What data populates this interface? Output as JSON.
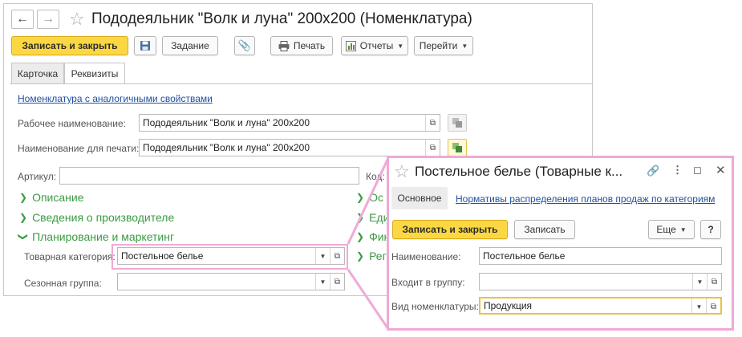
{
  "main": {
    "nav": {
      "back_icon": "arrow-left-icon",
      "forward_icon": "arrow-right-icon"
    },
    "title": "Пододеяльник \"Волк и луна\" 200х200 (Номенклатура)",
    "toolbar": {
      "save_close": "Записать и закрыть",
      "task": "Задание",
      "print": "Печать",
      "reports": "Отчеты",
      "goto": "Перейти"
    },
    "tabs": [
      "Карточка",
      "Реквизиты"
    ],
    "similar_link": "Номенклатура с аналогичными свойствами",
    "work_name_label": "Рабочее наименование:",
    "work_name_value": "Пододеяльник \"Волк и луна\" 200х200",
    "print_name_label": "Наименование для печати:",
    "print_name_value": "Пододеяльник \"Волк и луна\" 200х200",
    "article_label": "Артикул:",
    "article_value": "",
    "code_label": "Код:",
    "groups_left": [
      "Описание",
      "Сведения о производителе",
      "Планирование и маркетинг"
    ],
    "groups_right": [
      "Ос",
      "Еди",
      "Фин",
      "Рег"
    ],
    "category_label": "Товарная категория:",
    "category_value": "Постельное белье",
    "season_label": "Сезонная группа:",
    "season_value": ""
  },
  "popup": {
    "title": "Постельное белье (Товарные к...",
    "tab_main": "Основное",
    "norms_link": "Нормативы распределения планов продаж по категориям",
    "save_close": "Записать и закрыть",
    "save": "Записать",
    "more": "Еще",
    "help": "?",
    "name_label": "Наименование:",
    "name_value": "Постельное белье",
    "group_label": "Входит в группу:",
    "group_value": "",
    "kind_label": "Вид номенклатуры:",
    "kind_value": "Продукция"
  },
  "colors": {
    "accent_yellow": "#fbd843",
    "highlight_pink": "#f0a9d8",
    "group_green": "#3a9b41",
    "link_blue": "#1f4fa3"
  }
}
